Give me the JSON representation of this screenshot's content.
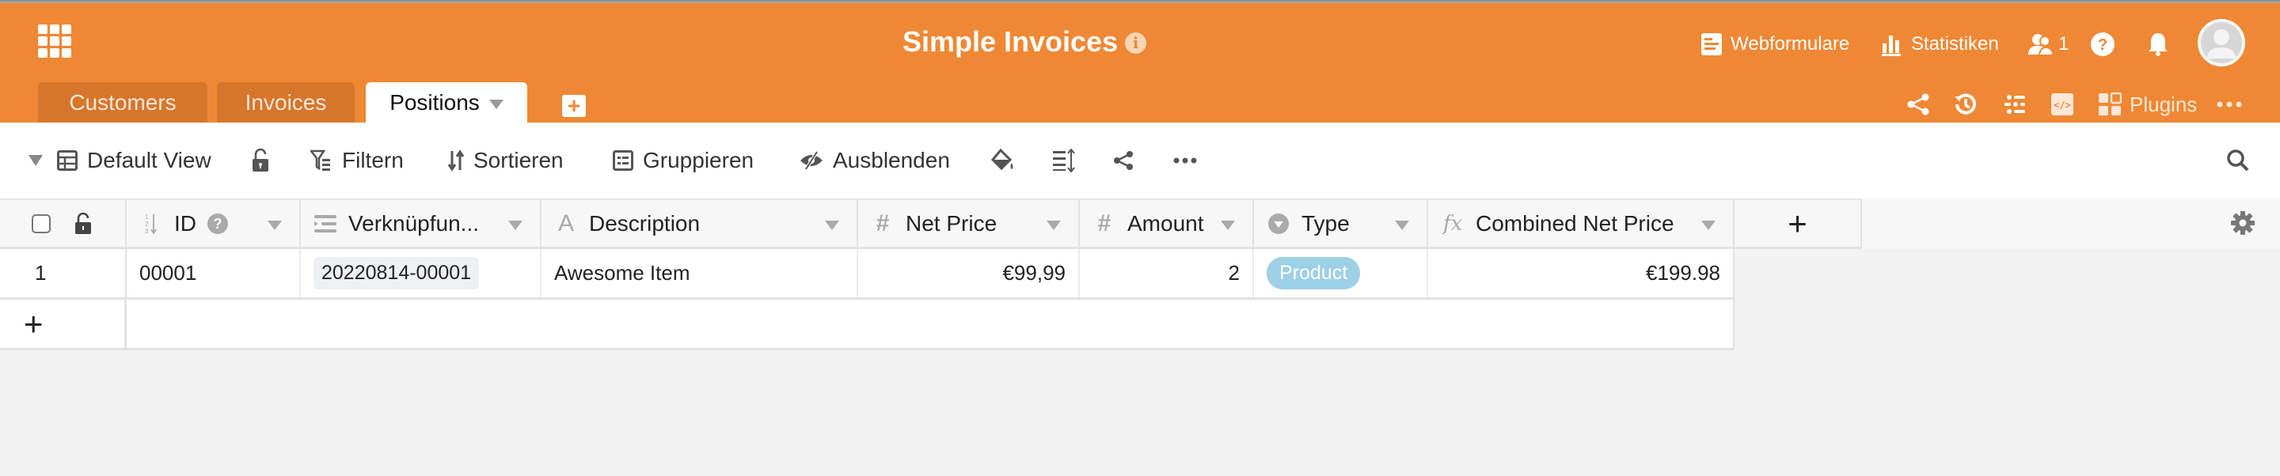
{
  "app": {
    "title": "Simple Invoices",
    "info_icon": "info-icon",
    "apps_icon": "apps-grid-icon"
  },
  "header_right": {
    "webforms": "Webformulare",
    "statistics": "Statistiken",
    "collaborators_count": "1",
    "help_icon": "question-circle-icon",
    "notifications_icon": "bell-icon",
    "avatar_icon": "user-avatar-icon"
  },
  "tabs": [
    {
      "label": "Customers",
      "active": false
    },
    {
      "label": "Invoices",
      "active": false
    },
    {
      "label": "Positions",
      "active": true
    }
  ],
  "add_tab_label": "+",
  "header_actions": {
    "share_icon": "share-icon",
    "history_icon": "history-icon",
    "settings_icon": "sliders-icon",
    "code_icon": "code-icon",
    "plugins": "Plugins",
    "more_icon": "more-dots-icon"
  },
  "toolbar": {
    "view_name": "Default View",
    "filter": "Filtern",
    "sort": "Sortieren",
    "group": "Gruppieren",
    "hide": "Ausblenden",
    "lock_icon": "unlock-icon",
    "color_icon": "paint-bucket-icon",
    "row_height_icon": "row-height-icon",
    "share_icon": "share-icon",
    "more_icon": "more-dots-icon",
    "search_icon": "search-icon"
  },
  "table": {
    "columns": [
      {
        "name": "ID",
        "type": "auto-number"
      },
      {
        "name": "Verknüpfun...",
        "type": "link"
      },
      {
        "name": "Description",
        "type": "text"
      },
      {
        "name": "Net Price",
        "type": "number"
      },
      {
        "name": "Amount",
        "type": "number"
      },
      {
        "name": "Type",
        "type": "single-select"
      },
      {
        "name": "Combined Net Price",
        "type": "formula"
      }
    ],
    "add_column_label": "+",
    "rows": [
      {
        "index": "1",
        "id": "00001",
        "link": "20220814-00001",
        "description": "Awesome Item",
        "net_price": "€99,99",
        "amount": "2",
        "type": "Product",
        "combined_net_price": "€199.98"
      }
    ],
    "add_row_label": "+"
  },
  "colors": {
    "brand": "#ef8834",
    "tab_inactive": "#d6762c",
    "type_product": "#9ed0e6"
  }
}
